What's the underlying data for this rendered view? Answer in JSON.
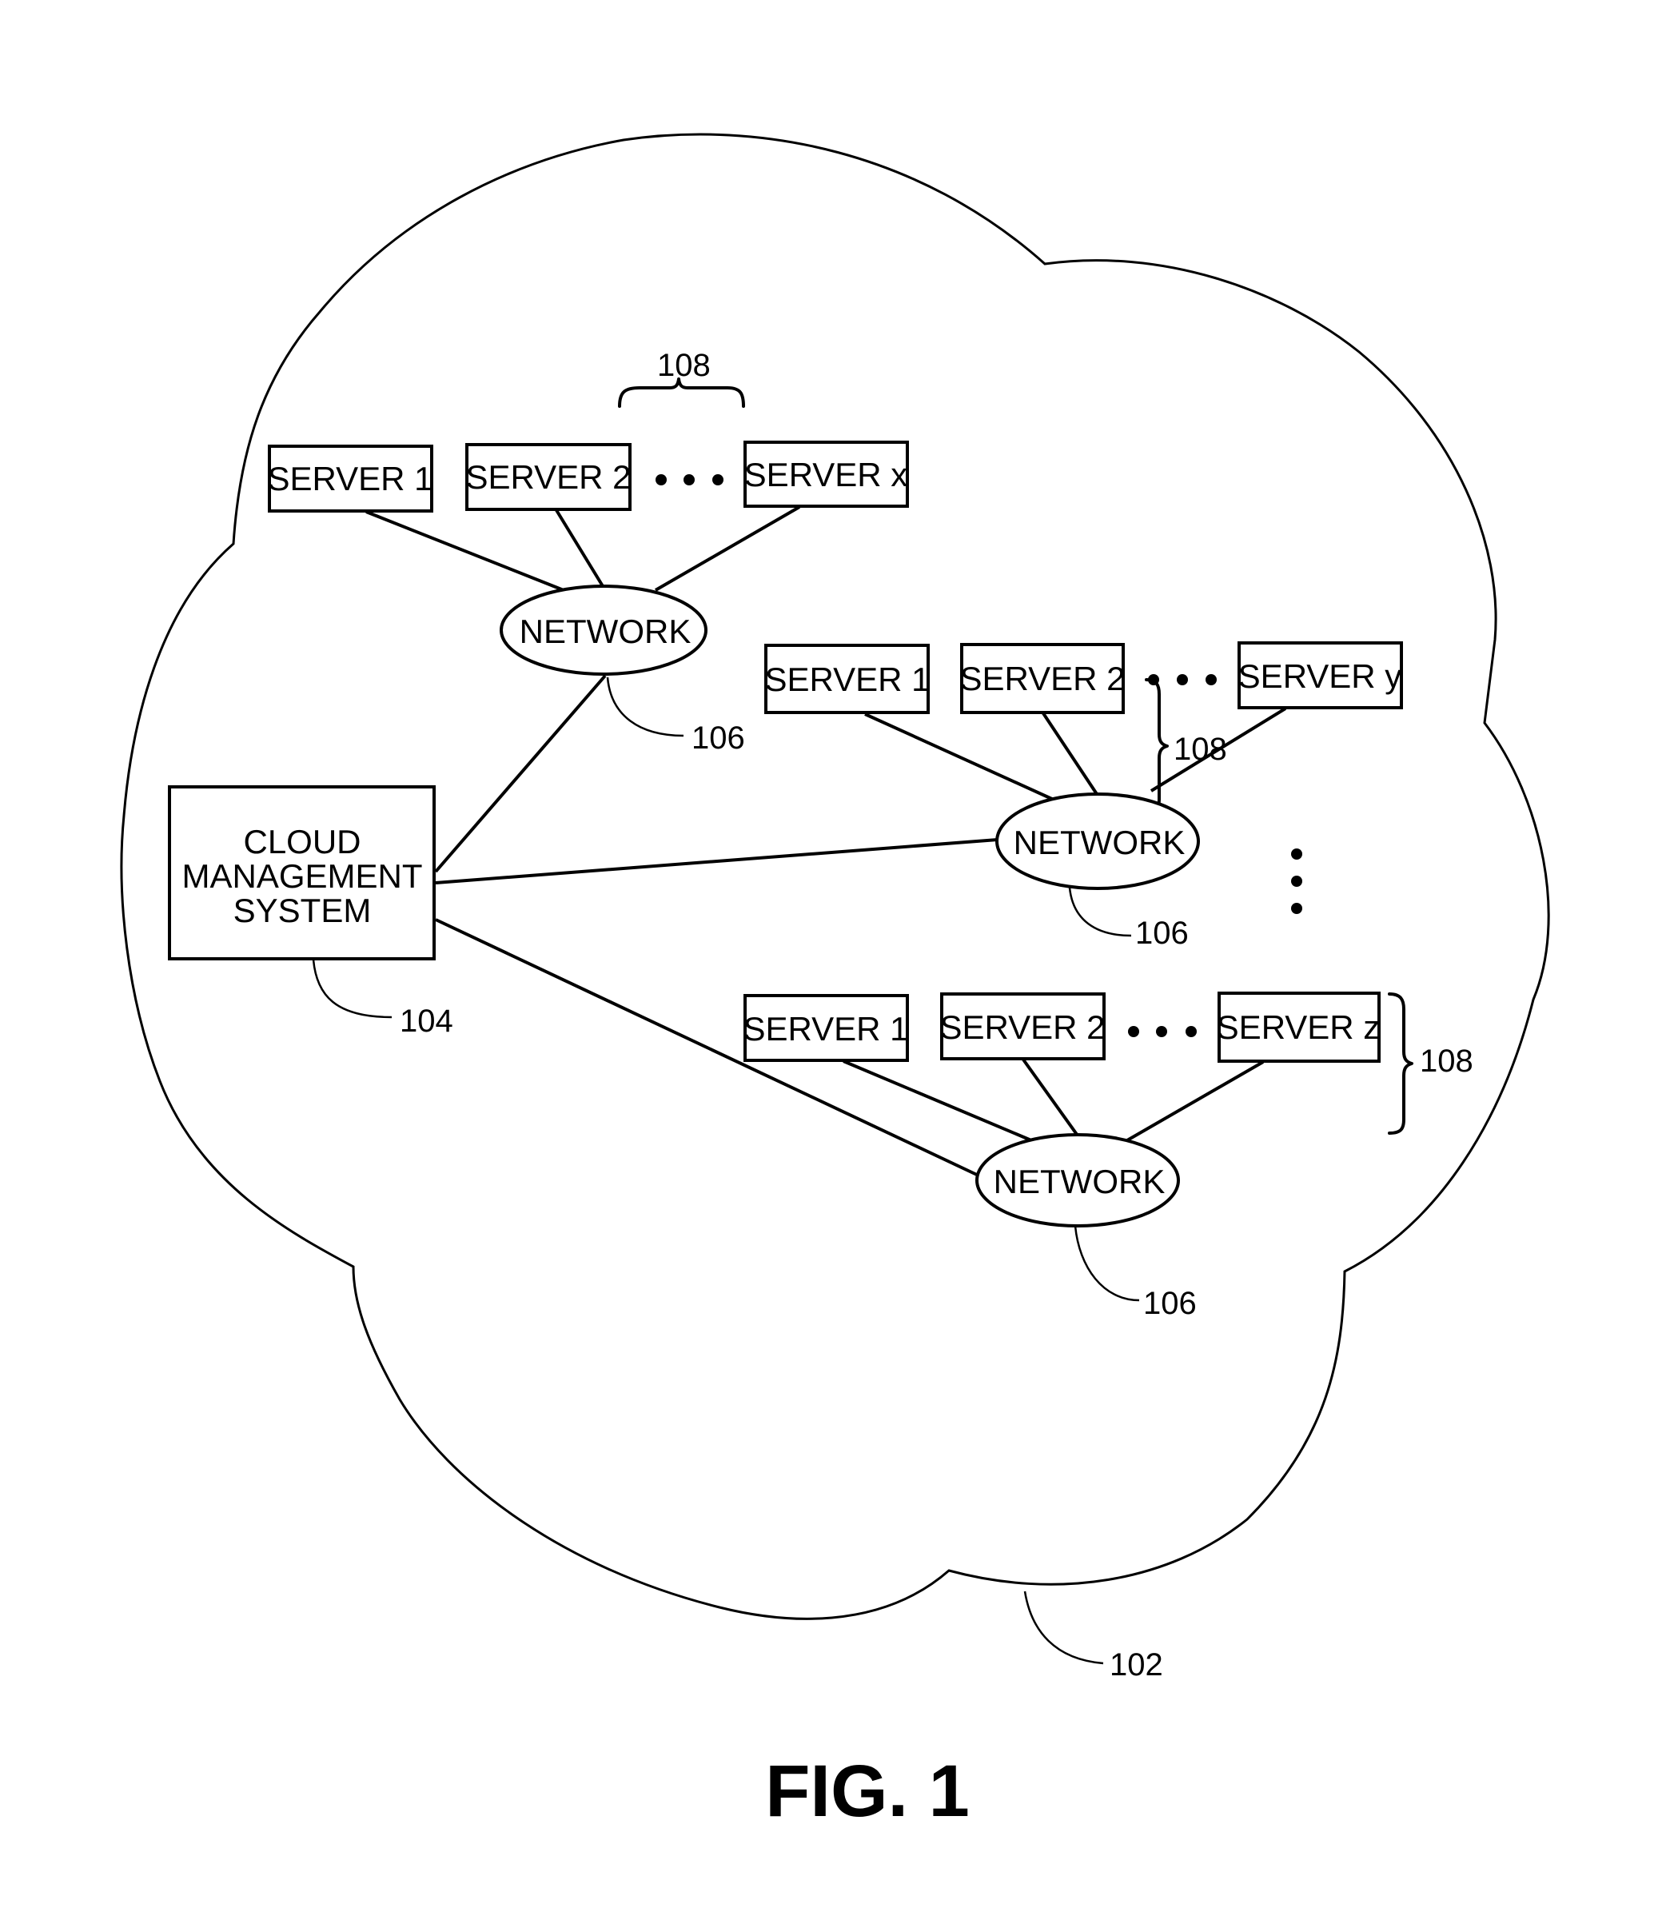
{
  "figure": {
    "caption": "FIG. 1",
    "cloud_ref": "102",
    "cloud_management_system": {
      "lines": [
        "CLOUD",
        "MANAGEMENT",
        "SYSTEM"
      ],
      "ref": "104"
    },
    "network_label": "NETWORK",
    "network_ref": "106",
    "server_group_ref": "108",
    "groups": [
      {
        "servers": [
          "SERVER 1",
          "SERVER 2",
          "SERVER x"
        ],
        "ellipsis": "• • •"
      },
      {
        "servers": [
          "SERVER 1",
          "SERVER 2",
          "SERVER y"
        ],
        "ellipsis": "• • •"
      },
      {
        "servers": [
          "SERVER 1",
          "SERVER 2",
          "SERVER z"
        ],
        "ellipsis": "• • •"
      }
    ],
    "vertical_ellipsis": "⋮"
  }
}
